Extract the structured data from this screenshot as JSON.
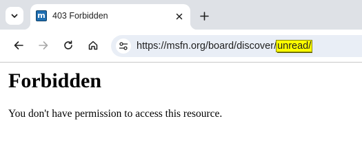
{
  "browser": {
    "tab": {
      "title": "403 Forbidden",
      "favicon_text": "m"
    },
    "toolbar": {
      "url_prefix": "https://msfn.org/board/discover/",
      "url_highlight": "unread/"
    },
    "icons": {
      "tab_search": "chevron-down-icon",
      "tab_close": "close-icon",
      "new_tab": "plus-icon",
      "back": "arrow-left-icon",
      "forward": "arrow-right-icon",
      "reload": "reload-icon",
      "home": "home-icon",
      "site_info": "tune-icon"
    },
    "colors": {
      "tabstrip": "#dee1e6",
      "omnibox": "#e9eef6",
      "highlight": "#ffff00"
    }
  },
  "page": {
    "heading": "Forbidden",
    "message": "You don't have permission to access this resource."
  }
}
